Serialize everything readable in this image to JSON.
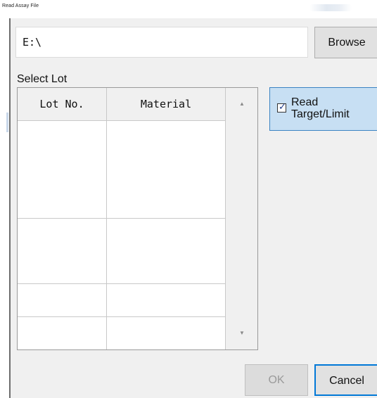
{
  "window": {
    "title": "Read Assay File"
  },
  "path": {
    "value": "E:\\"
  },
  "buttons": {
    "browse": "Browse",
    "ok": "OK",
    "cancel": "Cancel"
  },
  "lot_section": {
    "label": "Select Lot",
    "columns": [
      "Lot No.",
      "Material"
    ],
    "rows": [
      [
        "",
        ""
      ],
      [
        "",
        ""
      ],
      [
        "",
        ""
      ],
      [
        "",
        ""
      ],
      [
        "",
        ""
      ],
      [
        "",
        ""
      ],
      [
        "",
        ""
      ]
    ],
    "scroll_up_icon": "scroll-up-arrow",
    "scroll_down_icon": "scroll-down-arrow"
  },
  "options": {
    "read_target_limit": {
      "label": "Read Target/Limit",
      "checked": true
    }
  },
  "colors": {
    "toggle_bg": "#c7dff3",
    "toggle_border": "#3b83c3",
    "focus_border": "#0078d7"
  }
}
